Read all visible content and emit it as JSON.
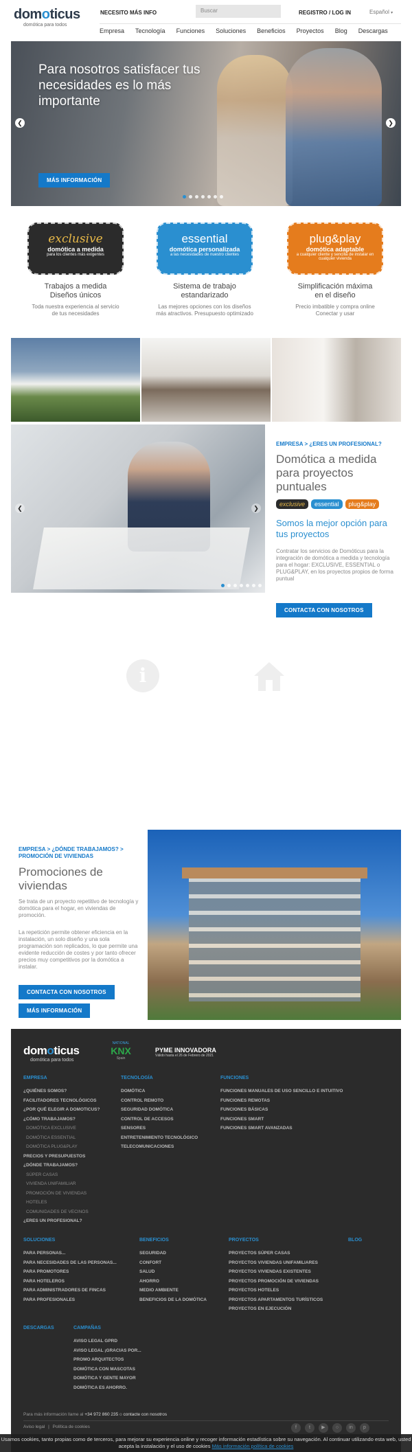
{
  "header": {
    "logo_text_1": "dom",
    "logo_text_o": "o",
    "logo_text_2": "ticus",
    "logo_tagline": "domótica para todos",
    "help_link": "NECESITO MÁS INFO",
    "search_placeholder": "Buscar",
    "login_link": "REGISTRO / LOG IN",
    "language": "Español"
  },
  "nav": [
    "Empresa",
    "Tecnología",
    "Funciones",
    "Soluciones",
    "Beneficios",
    "Proyectos",
    "Blog",
    "Descargas"
  ],
  "hero": {
    "headline": "Para nosotros satisfacer tus necesidades es lo más importante",
    "button": "MÁS INFORMACIÓN",
    "dots": 7,
    "active_dot": 0
  },
  "plans": [
    {
      "badge_title": "exclusive",
      "badge_sub": "domótica a medida",
      "badge_small": "para los clientes más exigentes",
      "color": "#2b2b2b",
      "title1": "Trabajos a medida",
      "title2": "Diseños únicos",
      "desc1": "Toda nuestra experiencia al servicio",
      "desc2": "de tus necesidades"
    },
    {
      "badge_title": "essential",
      "badge_sub": "domótica personalizada",
      "badge_small": "a las necesidades de nuestro clientes",
      "color": "#2a8fd0",
      "title1": "Sistema de trabajo",
      "title2": "estandarizado",
      "desc1": "Las mejores opciones con los diseños",
      "desc2": "más atractivos. Presupuesto optimizado"
    },
    {
      "badge_title": "plug&play",
      "badge_sub": "domótica adaptable",
      "badge_small": "a cualquier cliente y sencilla de instalar en cualquier vivienda",
      "color": "#e57c1d",
      "title1": "Simplificación máxima",
      "title2": "en el diseño",
      "desc1": "Precio imbatible y compra online",
      "desc2": "Conectar y usar"
    }
  ],
  "pro": {
    "crumb": "EMPRESA > ¿ERES UN PROFESIONAL?",
    "title": "Domótica a medida para proyectos puntuales",
    "pills": [
      "exclusive",
      "essential",
      "plug&play"
    ],
    "subtitle": "Somos la mejor opción para tus proyectos",
    "body": "Contratar los servicios de Domóticus para la integración de domótica a medida y tecnología para el hogar: EXCLUSIVE, ESSENTIAL o PLUG&PLAY, en los proyectos propios de forma puntual",
    "button": "CONTACTA CON NOSOTROS",
    "dots": 7
  },
  "promo": {
    "crumb1": "EMPRESA > ¿DÓNDE TRABAJAMOS? >",
    "crumb2": "PROMOCIÓN DE VIVIENDAS",
    "title": "Promociones de viviendas",
    "body1": "Se trata de un proyecto repetitivo de tecnología y domótica para el hogar, en viviendas de promoción.",
    "body2": "La repetición permite obtener eficiencia en la instalación, un solo diseño y una sola programación son replicados, lo que permite una evidente reducción de costes y por tanto ofrecer precios muy competitivos por la domótica a instalar.",
    "button1": "CONTACTA CON NOSOTROS",
    "button2": "MÁS INFORMACIÓN"
  },
  "footer": {
    "logo_tagline": "domótica para todos",
    "knx_top": "NATIONAL",
    "knx": "KNX",
    "knx_sub": "Spain",
    "pyme_title": "PYME INNOVADORA",
    "pyme_sub": "Válido hasta el 26 de Febrero de 2021",
    "col_empresa": {
      "head": "EMPRESA",
      "items": [
        {
          "t": "¿QUIÉNES SOMOS?",
          "sub": false
        },
        {
          "t": "FACILITADORES TECNOLÓGICOS",
          "sub": false
        },
        {
          "t": "¿POR QUÉ ELEGIR A DOMOTICUS?",
          "sub": false
        },
        {
          "t": "¿CÓMO TRABAJAMOS?",
          "sub": false
        },
        {
          "t": "DOMÓTICA EXCLUSIVE",
          "sub": true
        },
        {
          "t": "DOMÓTICA ESSENTIAL",
          "sub": true
        },
        {
          "t": "DOMÓTICA PLUG&PLAY",
          "sub": true
        },
        {
          "t": "PRECIOS Y PRESUPUESTOS",
          "sub": false
        },
        {
          "t": "¿DÓNDE TRABAJAMOS?",
          "sub": false
        },
        {
          "t": "SÚPER CASAS",
          "sub": true
        },
        {
          "t": "VIVIENDA UNIFAMILIAR",
          "sub": true
        },
        {
          "t": "PROMOCIÓN DE VIVIENDAS",
          "sub": true
        },
        {
          "t": "HOTELES",
          "sub": true
        },
        {
          "t": "COMUNIDADES DE VECINOS",
          "sub": true
        },
        {
          "t": "¿ERES UN PROFESIONAL?",
          "sub": false
        }
      ]
    },
    "col_tecnologia": {
      "head": "TECNOLOGÍA",
      "items": [
        "DOMÓTICA",
        "CONTROL REMOTO",
        "SEGURIDAD DOMÓTICA",
        "CONTROL DE ACCESOS",
        "SENSORES",
        "ENTRETENIMIENTO TECNOLÓGICO",
        "TELECOMUNICACIONES"
      ]
    },
    "col_funciones": {
      "head": "FUNCIONES",
      "items": [
        "FUNCIONES MANUALES DE USO SENCILLO E INTUITIVO",
        "FUNCIONES REMOTAS",
        "FUNCIONES BÁSICAS",
        "FUNCIONES SMART",
        "FUNCIONES SMART AVANZADAS"
      ]
    },
    "col_soluciones": {
      "head": "SOLUCIONES",
      "items": [
        "PARA PERSONAS...",
        "PARA NECESIDADES DE LAS PERSONAS...",
        "PARA PROMOTORES",
        "PARA HOTELEROS",
        "PARA ADMINISTRADORES DE FINCAS",
        "PARA PROFESIONALES"
      ]
    },
    "col_beneficios": {
      "head": "BENEFICIOS",
      "items": [
        "SEGURIDAD",
        "CONFORT",
        "SALUD",
        "AHORRO",
        "MEDIO AMBIENTE",
        "BENEFICIOS DE LA DOMÓTICA"
      ]
    },
    "col_proyectos": {
      "head": "PROYECTOS",
      "items": [
        "PROYECTOS SÚPER CASAS",
        "PROYECTOS VIVIENDAS UNIFAMILIARES",
        "PROYECTOS VIVIENDAS EXISTENTES",
        "PROYECTOS PROMOCIÓN DE VIVIENDAS",
        "PROYECTOS HOTELES",
        "PROYECTOS APARTAMENTOS TURÍSTICOS",
        "PROYECTOS EN EJECUCIÓN"
      ]
    },
    "col_blog": {
      "head": "BLOG"
    },
    "col_descargas": {
      "head": "DESCARGAS"
    },
    "col_campanas": {
      "head": "CAMPAÑAS",
      "items": [
        "AVISO LEGAL GPRD",
        "AVISO LEGAL ¡GRACIAS POR...",
        "PROMO ARQUITECTOS",
        "DOMÓTICA CON MASCOTAS",
        "DOMÓTICA Y GENTE MAYOR",
        "DOMÓTICA ES AHORRO."
      ]
    },
    "contact_pre": "Para más información llame al",
    "phone": "+34 972 860 235",
    "contact_mid": "o",
    "contact_link": "contacte con nosotros",
    "legal": "Aviso legal",
    "cookies": "Política de cookies"
  },
  "cookie_bar": {
    "text": "Usamos cookies, tanto propias como de terceros, para mejorar su experiencia online y recoger información estadística sobre su navegación. Al continuar utilizando esta web, usted acepta la instalación y el uso de cookies",
    "link": "Más información política de cookies"
  }
}
